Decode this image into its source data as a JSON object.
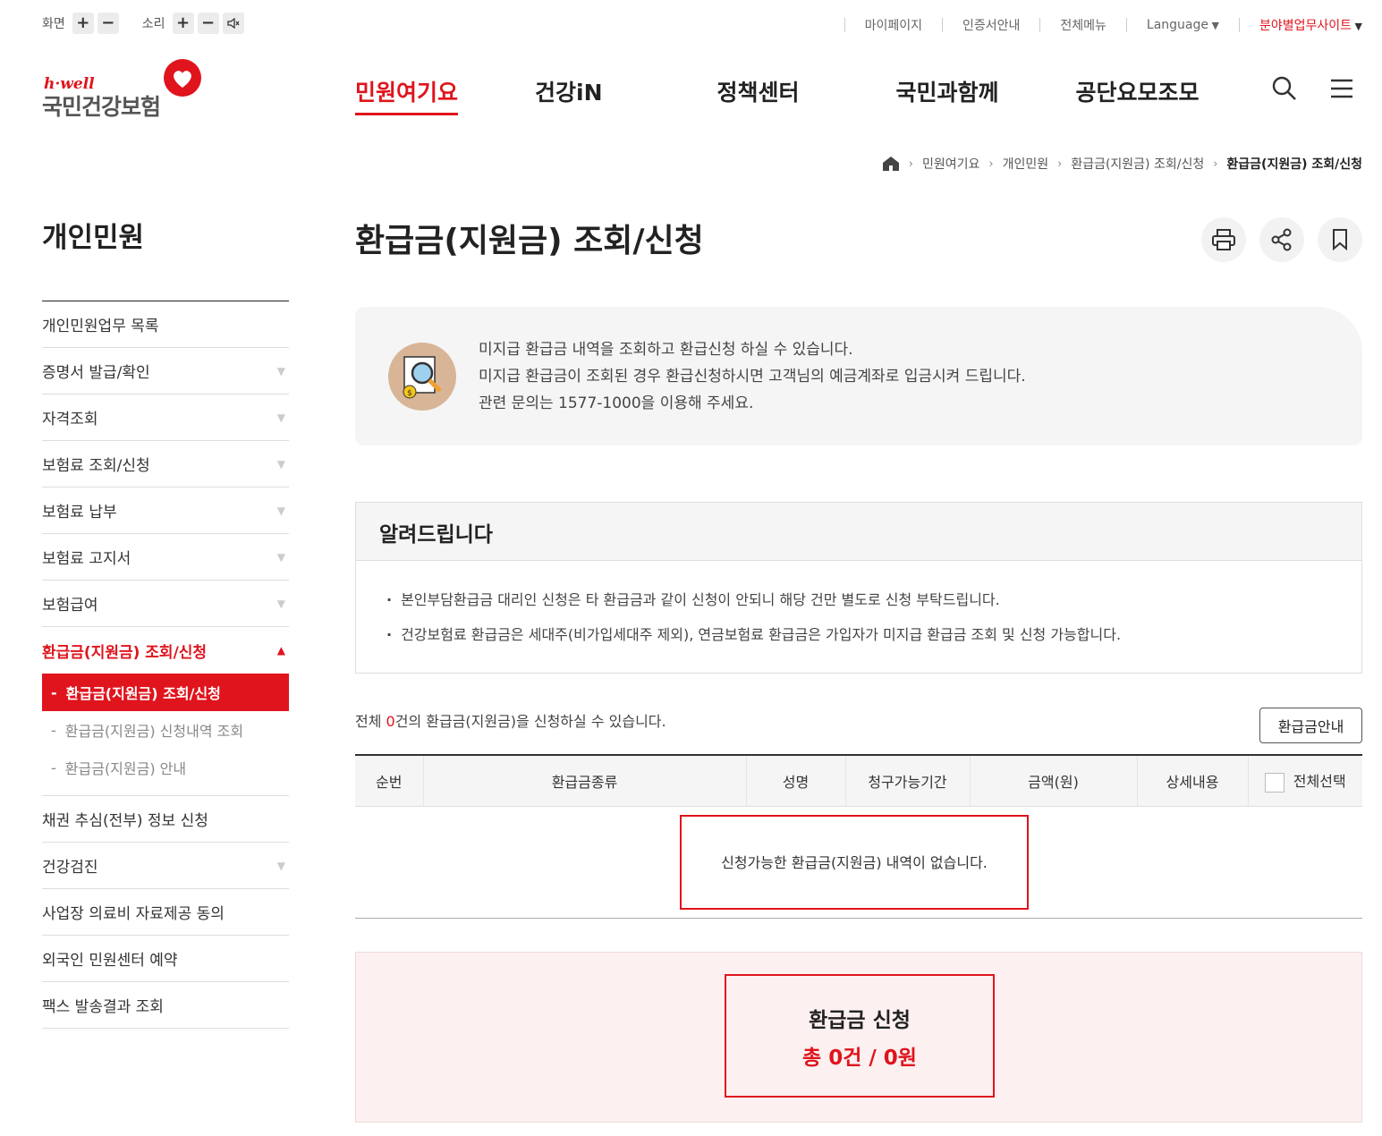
{
  "util": {
    "screen_label": "화면",
    "sound_label": "소리",
    "plus": "+",
    "minus": "−",
    "links": [
      "마이페이지",
      "인증서안내",
      "전체메뉴"
    ],
    "language": "Language",
    "field_sites": "분야별업무사이트"
  },
  "logo": {
    "hwell": "h·well",
    "name": "국민건강보험"
  },
  "gnb": [
    "민원여기요",
    "건강iN",
    "정책센터",
    "국민과함께",
    "공단요모조모"
  ],
  "breadcrumb": [
    "민원여기요",
    "개인민원",
    "환급금(지원금) 조회/신청",
    "환급금(지원금) 조회/신청"
  ],
  "sidebar": {
    "title": "개인민원",
    "items": [
      {
        "label": "개인민원업무 목록"
      },
      {
        "label": "증명서 발급/확인"
      },
      {
        "label": "자격조회"
      },
      {
        "label": "보험료 조회/신청"
      },
      {
        "label": "보험료 납부"
      },
      {
        "label": "보험료 고지서"
      },
      {
        "label": "보험급여"
      },
      {
        "label": "환급금(지원금) 조회/신청"
      },
      {
        "label": "채권 추심(전부) 정보 신청"
      },
      {
        "label": "건강검진"
      },
      {
        "label": "사업장 의료비 자료제공 동의"
      },
      {
        "label": "외국인 민원센터 예약"
      },
      {
        "label": "팩스 발송결과 조회"
      }
    ],
    "sub": [
      "환급금(지원금) 조회/신청",
      "환급금(지원금) 신청내역 조회",
      "환급금(지원금) 안내"
    ]
  },
  "page": {
    "title": "환급금(지원금) 조회/신청",
    "intro": [
      "미지급 환급금 내역을 조회하고 환급신청 하실 수 있습니다.",
      "미지급 환급금이 조회된 경우 환급신청하시면 고객님의 예금계좌로 입금시켜 드립니다.",
      "관련 문의는 1577-1000을 이용해 주세요."
    ],
    "notice_title": "알려드립니다",
    "notice": [
      "본인부담환급금 대리인 신청은 타 환급금과 같이 신청이 안되니 해당 건만 별도로 신청 부탁드립니다.",
      "건강보험료 환급금은 세대주(비가입세대주 제외), 연금보험료 환급금은 가입자가 미지급 환급금 조회 및 신청 가능합니다."
    ],
    "count_pre": "전체 ",
    "count": "0",
    "count_post": "건의 환급금(지원금)을 신청하실 수 있습니다.",
    "guide_button": "환급금안내",
    "columns": [
      "순번",
      "환급금종류",
      "성명",
      "청구가능기간",
      "금액(원)",
      "상세내용",
      "전체선택"
    ],
    "empty_message": "신청가능한 환급금(지원금) 내역이 없습니다.",
    "apply_title": "환급금 신청",
    "apply_total": "총 0건 / 0원"
  },
  "colors": {
    "accent": "#e0141d"
  }
}
